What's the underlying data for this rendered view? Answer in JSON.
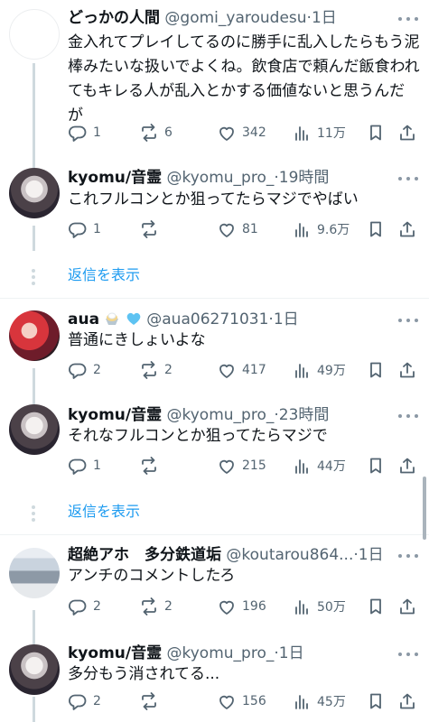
{
  "tweets": [
    {
      "name": "どっかの人間",
      "handle": "@gomi_yaroudesu",
      "time": "1日",
      "text": "金入れてプレイしてるのに勝手に乱入したらもう泥棒みたいな扱いでよくね。飲食店で頼んだ飯食われてもキレる人が乱入とかする価値ないと思うんだが",
      "replies": "1",
      "retweets": "6",
      "likes": "342",
      "views": "11万"
    },
    {
      "name": "kyomu/音霊",
      "handle": "@kyomu_pro_",
      "time": "19時間",
      "text": "これフルコンとか狙ってたらマジでやばい",
      "replies": "1",
      "retweets": "",
      "likes": "81",
      "views": "9.6万"
    },
    {
      "name": "aua",
      "handle": "@aua06271031",
      "time": "1日",
      "text": "普通にきしょいよな",
      "replies": "2",
      "retweets": "2",
      "likes": "417",
      "views": "49万"
    },
    {
      "name": "kyomu/音霊",
      "handle": "@kyomu_pro_",
      "time": "23時間",
      "text": "それなフルコンとか狙ってたらマジで",
      "replies": "1",
      "retweets": "",
      "likes": "215",
      "views": "44万"
    },
    {
      "name": "超絶アホ　多分鉄道垢",
      "handle": "@koutarou864...",
      "time": "1日",
      "text": "アンチのコメントしたろ",
      "replies": "2",
      "retweets": "2",
      "likes": "196",
      "views": "50万"
    },
    {
      "name": "kyomu/音霊",
      "handle": "@kyomu_pro_",
      "time": "1日",
      "text": "多分もう消されてる...",
      "replies": "2",
      "retweets": "",
      "likes": "156",
      "views": "45万"
    }
  ],
  "show_replies_label": "返信を表示",
  "separator_dot": "·",
  "icons": [
    "reply-icon",
    "retweet-icon",
    "like-icon",
    "views-icon",
    "bookmark-icon",
    "share-icon",
    "more-icon"
  ],
  "colors": {
    "link": "#1d9bf0",
    "secondary": "#536471",
    "text": "#0f1419"
  }
}
